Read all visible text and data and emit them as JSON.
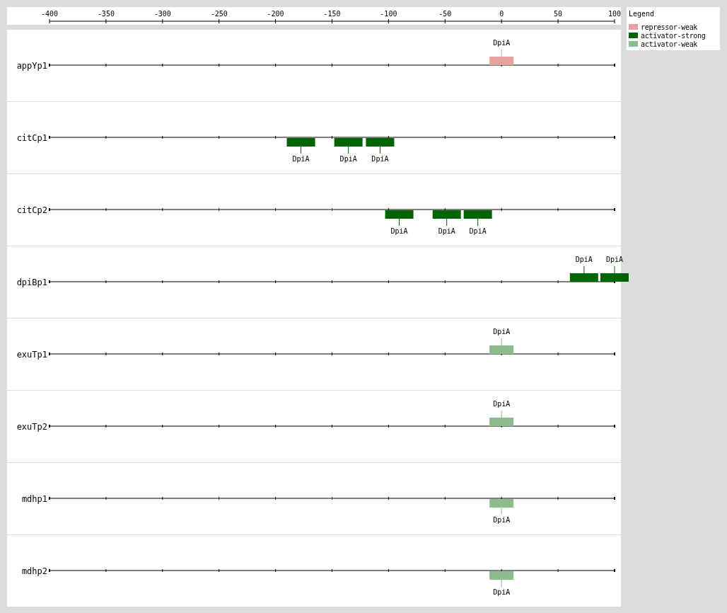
{
  "axis": {
    "ticks": [
      "-400",
      "-350",
      "-300",
      "-250",
      "-200",
      "-150",
      "-100",
      "-50",
      "0",
      "50",
      "100"
    ]
  },
  "legend": {
    "title": "Legend",
    "items": [
      {
        "label": "repressor-weak",
        "color": "#e6a1a1"
      },
      {
        "label": "activator-strong",
        "color": "#006400"
      },
      {
        "label": "activator-weak",
        "color": "#8fbc8f"
      }
    ]
  },
  "promoters": [
    {
      "name": "appYp1",
      "sites": [
        {
          "label": "DpiA",
          "kind": "weak",
          "color": "#e6a1a1",
          "level": 0.8,
          "above": true
        }
      ]
    },
    {
      "name": "citCp1",
      "sites": [
        {
          "label": "DpiA",
          "kind": "strong",
          "color": "#006400",
          "level": 0.445,
          "above": false
        },
        {
          "label": "DpiA",
          "kind": "strong",
          "color": "#006400",
          "level": 0.529,
          "above": false
        },
        {
          "label": "DpiA",
          "kind": "strong",
          "color": "#006400",
          "level": 0.585,
          "above": false
        }
      ]
    },
    {
      "name": "citCp2",
      "sites": [
        {
          "label": "DpiA",
          "kind": "strong",
          "color": "#006400",
          "level": 0.619,
          "above": false
        },
        {
          "label": "DpiA",
          "kind": "strong",
          "color": "#006400",
          "level": 0.703,
          "above": false
        },
        {
          "label": "DpiA",
          "kind": "strong",
          "color": "#006400",
          "level": 0.758,
          "above": false
        }
      ]
    },
    {
      "name": "dpiBp1",
      "sites": [
        {
          "label": "DpiA",
          "kind": "strong",
          "color": "#006400",
          "level": 0.946,
          "above": true
        },
        {
          "label": "DpiA",
          "kind": "strong",
          "color": "#006400",
          "level": 1,
          "above": true
        }
      ]
    },
    {
      "name": "exuTp1",
      "sites": [
        {
          "label": "DpiA",
          "kind": "weak",
          "color": "#8fbc8f",
          "level": 0.8,
          "above": true
        }
      ]
    },
    {
      "name": "exuTp2",
      "sites": [
        {
          "label": "DpiA",
          "kind": "weak",
          "color": "#8fbc8f",
          "level": 0.8,
          "above": true
        }
      ]
    },
    {
      "name": "mdhp1",
      "sites": [
        {
          "label": "DpiA",
          "kind": "weak",
          "color": "#8fbc8f",
          "level": 0.8,
          "above": false
        }
      ]
    },
    {
      "name": "mdhp2",
      "sites": [
        {
          "label": "DpiA",
          "kind": "weak",
          "color": "#8fbc8f",
          "level": 0.8,
          "above": false
        }
      ]
    }
  ]
}
